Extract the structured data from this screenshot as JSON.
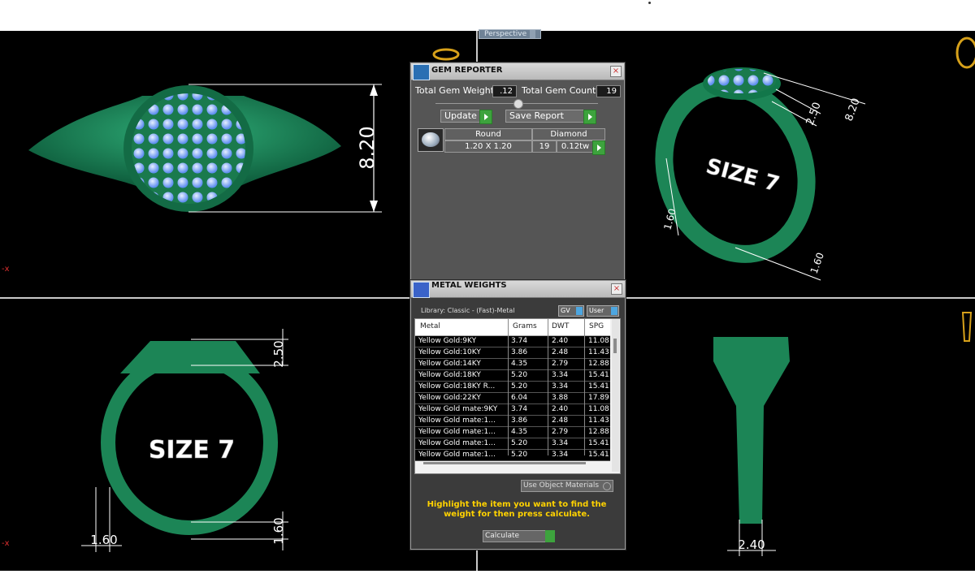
{
  "viewport": {
    "label": "Perspective",
    "axis_marker": "x",
    "dimensions": {
      "top_left_height": "8.20",
      "top_right_height_a": "2.50",
      "top_right_height_b": "8.20",
      "top_right_width_a": "1.60",
      "top_right_width_b": "1.60",
      "bottom_left_top": "2.50",
      "bottom_left_bottom": "1.60",
      "bottom_left_width": "1.60",
      "bottom_right_width": "2.40",
      "size_text_right": "SIZE 7",
      "size_text_left": "SIZE 7"
    }
  },
  "gem_reporter": {
    "title": "GEM REPORTER",
    "total_weight_label": "Total Gem Weight",
    "total_weight_value": ".12",
    "total_count_label": "Total Gem Count",
    "total_count_value": "19",
    "update_label": "Update",
    "save_report_label": "Save Report",
    "gem": {
      "shape": "Round",
      "size": "1.20 X 1.20",
      "material": "Diamond",
      "count": "19",
      "weight": "0.12tw"
    }
  },
  "metal_weights": {
    "title": "METAL WEIGHTS",
    "library_label": "Library: Classic - (Fast)-Metal",
    "gv_label": "GV",
    "user_label": "User",
    "columns": [
      "Metal",
      "Grams",
      "DWT",
      "SPG"
    ],
    "rows": [
      {
        "metal": "Yellow Gold:9KY",
        "grams": "3.74",
        "dwt": "2.40",
        "spg": "11.08"
      },
      {
        "metal": "Yellow Gold:10KY",
        "grams": "3.86",
        "dwt": "2.48",
        "spg": "11.43"
      },
      {
        "metal": "Yellow Gold:14KY",
        "grams": "4.35",
        "dwt": "2.79",
        "spg": "12.88"
      },
      {
        "metal": "Yellow Gold:18KY",
        "grams": "5.20",
        "dwt": "3.34",
        "spg": "15.41"
      },
      {
        "metal": "Yellow Gold:18KY R...",
        "grams": "5.20",
        "dwt": "3.34",
        "spg": "15.41"
      },
      {
        "metal": "Yellow Gold:22KY",
        "grams": "6.04",
        "dwt": "3.88",
        "spg": "17.89"
      },
      {
        "metal": "Yellow Gold mate:9KY",
        "grams": "3.74",
        "dwt": "2.40",
        "spg": "11.08"
      },
      {
        "metal": "Yellow Gold mate:1...",
        "grams": "3.86",
        "dwt": "2.48",
        "spg": "11.43"
      },
      {
        "metal": "Yellow Gold mate:1...",
        "grams": "4.35",
        "dwt": "2.79",
        "spg": "12.88"
      },
      {
        "metal": "Yellow Gold mate:1...",
        "grams": "5.20",
        "dwt": "3.34",
        "spg": "15.41"
      },
      {
        "metal": "Yellow Gold mate:1...",
        "grams": "5.20",
        "dwt": "3.34",
        "spg": "15.41"
      }
    ],
    "material_select": "Use Object Materials",
    "hint": "Highlight the item you want to find the weight for then press calculate.",
    "calculate_label": "Calculate"
  },
  "colors": {
    "ring_green": "#1f8a5c",
    "gem_blue": "#7fb0ff",
    "dimension_white": "#ffffff",
    "accent_yellow": "#ffd200",
    "accent_green": "#3da33d"
  }
}
